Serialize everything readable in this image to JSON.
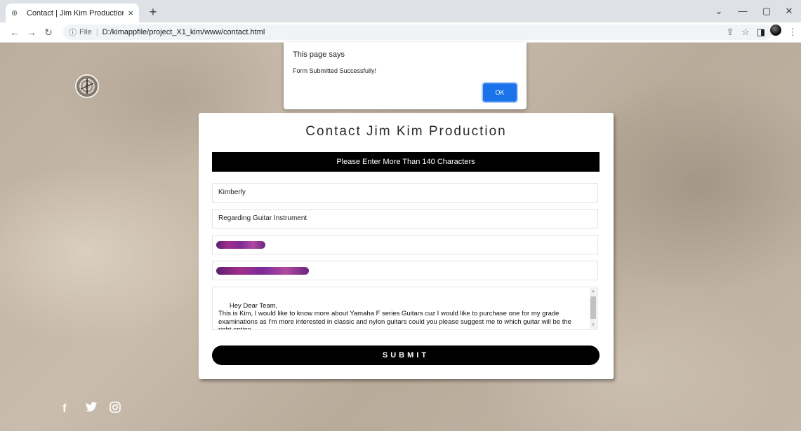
{
  "browser": {
    "tab_title": "Contact | Jim Kim Production",
    "tab_close": "×",
    "new_tab": "+",
    "url_scheme": "File",
    "url_path": "D:/kimappfile/project_X1_kim/www/contact.html",
    "icons": {
      "favicon": "site-logo-icon",
      "back": "arrow-left-icon",
      "forward": "arrow-right-icon",
      "reload": "reload-icon",
      "info": "info-icon",
      "share": "share-icon",
      "bookmark": "star-icon",
      "sidepanel": "side-panel-icon",
      "menu": "kebab-menu-icon",
      "minimize": "minimize-icon",
      "maximize": "restore-icon",
      "close": "close-icon",
      "tab_search": "chevron-down-icon"
    }
  },
  "dialog": {
    "heading": "This page says",
    "message": "Form Submitted Successfully!",
    "ok_label": "OK"
  },
  "form": {
    "title": "Contact Jim Kim Production",
    "banner": "Please Enter More Than 140 Characters",
    "name_value": "Kimberly",
    "subject_value": "Regarding Guitar Instrument",
    "message_value": "Hey Dear Team,\nThis is Kim, I would like to know more about Yamaha F series Guitars cuz I would like to purchase one for my grade examinations as I'm more interested in classic and nylon guitars could you please suggest me to which guitar will be the right option.",
    "submit_label": "SUBMIT"
  },
  "social": {
    "facebook": "f",
    "twitter": "twitter-icon",
    "instagram": "instagram-icon"
  },
  "colors": {
    "button": "#000000",
    "dialog_ok": "#1a73e8",
    "redaction": "#8a2a8f"
  }
}
